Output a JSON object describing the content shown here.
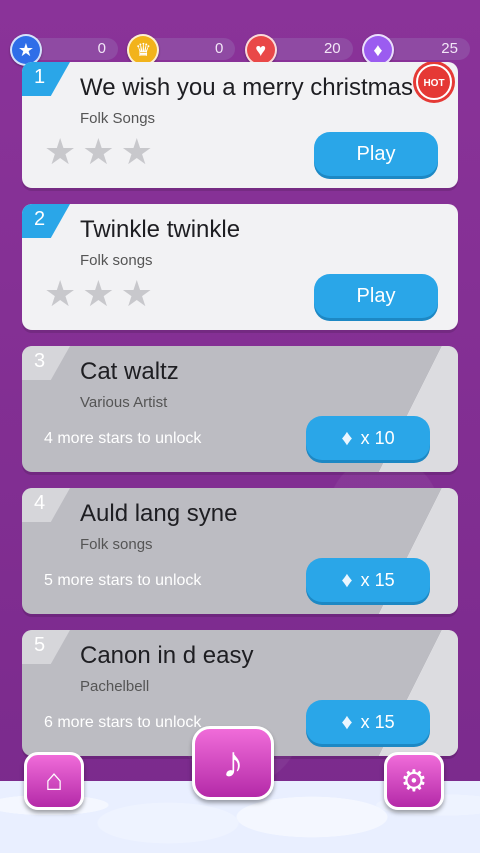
{
  "stats": {
    "stars": {
      "value": "0",
      "icon": "star-icon",
      "color": "#2f6ee8"
    },
    "crowns": {
      "value": "0",
      "icon": "crown-icon",
      "color": "#f2b31b"
    },
    "hearts": {
      "value": "20",
      "icon": "heart-icon",
      "color": "#e94848"
    },
    "gems": {
      "value": "25",
      "icon": "diamond-icon",
      "color": "#9b5cf0"
    }
  },
  "songs": [
    {
      "number": "1",
      "title": "We wish you a merry christmas",
      "artist": "Folk Songs",
      "badge": "HOT",
      "stars_earned": 0,
      "stars_total": 3,
      "action": "Play",
      "locked": false
    },
    {
      "number": "2",
      "title": "Twinkle twinkle",
      "artist": "Folk songs",
      "stars_earned": 0,
      "stars_total": 3,
      "action": "Play",
      "locked": false
    },
    {
      "number": "3",
      "title": "Cat waltz",
      "artist": "Various Artist",
      "unlock_text": "4 more stars to unlock",
      "gem_cost": "x 10",
      "locked": true
    },
    {
      "number": "4",
      "title": "Auld lang syne",
      "artist": "Folk songs",
      "unlock_text": "5 more stars to unlock",
      "gem_cost": "x 15",
      "locked": true
    },
    {
      "number": "5",
      "title": "Canon in d easy",
      "artist": "Pachelbell",
      "unlock_text": "6 more stars to unlock",
      "gem_cost": "x 15",
      "locked": true
    }
  ],
  "nav": {
    "home": {
      "icon": "home-icon"
    },
    "music": {
      "icon": "music-note-icon"
    },
    "settings": {
      "icon": "gear-icon"
    }
  },
  "colors": {
    "accent": "#2aa6e8",
    "background": "#7a2a8c",
    "nav_button": "#d94fc9"
  }
}
